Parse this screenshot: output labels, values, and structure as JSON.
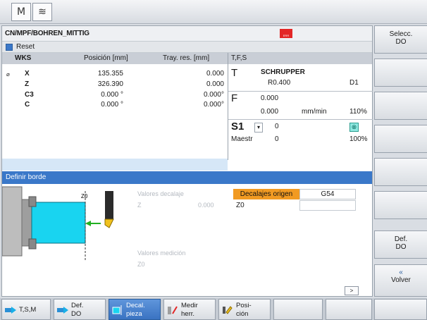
{
  "topbar": {
    "machine_icon": "M",
    "program_icon": "≋"
  },
  "program_path": "CN/MPF/BOHREN_MITTIG",
  "alarm_flag": {
    "color": "#e32626",
    "text": "ERR"
  },
  "reset": {
    "label": "Reset"
  },
  "position_panel": {
    "headers": {
      "wks": "WKS",
      "position": "Posición [mm]",
      "distance": "Tray. res. [mm]"
    },
    "rows": [
      {
        "mark": "⌀",
        "axis": "X",
        "position": "135.355",
        "distance": "0.000"
      },
      {
        "mark": "",
        "axis": "Z",
        "position": "326.390",
        "distance": "0.000"
      },
      {
        "mark": "",
        "axis": "C3",
        "position": "0.000 °",
        "distance": "0.000°"
      },
      {
        "mark": "",
        "axis": "C",
        "position": "0.000 °",
        "distance": "0.000°"
      }
    ]
  },
  "tfs_panel": {
    "header": "T,F,S",
    "t_label": "T",
    "tool_name": "SCHRUPPER",
    "tool_radius": "R0.400",
    "tool_d": "D1",
    "f_label": "F",
    "feed_value": "0.000",
    "feed_value2": "0.000",
    "feed_unit": "mm/min",
    "feed_override": "110%",
    "s_label": "S1",
    "spindle_value": "0",
    "spindle_mode": "Maestr",
    "spindle_value2": "0",
    "spindle_override": "100%"
  },
  "window_title": "Definir borde",
  "graphic": {
    "z0_label": "Z0"
  },
  "offset_form": {
    "offset_label": "Valores decalaje",
    "offset_z_label": "Z",
    "offset_z_value": "0.000",
    "measure_label": "Valores medición",
    "measure_z0_label": "Z0",
    "zero_offsets_label": "Decalajes origen",
    "zero_offset_value": "G54",
    "z0_label": "Z0",
    "more_button": ">"
  },
  "vertical_softkeys": {
    "select_do_1": "Selecc.",
    "select_do_2": "DO",
    "def_do_1": "Def.",
    "def_do_2": "DO",
    "back_arrow": "«",
    "back_label": "Volver"
  },
  "horizontal_softkeys": [
    {
      "line1": "T,S,M",
      "line2": "",
      "active": false
    },
    {
      "line1": "Def.",
      "line2": "DO",
      "active": false
    },
    {
      "line1": "Decal.",
      "line2": "pieza",
      "active": true
    },
    {
      "line1": "Medir",
      "line2": "herr.",
      "active": false
    },
    {
      "line1": "Posi-",
      "line2": "ción",
      "active": false
    }
  ],
  "colors": {
    "accent_blue": "#3a78c9",
    "orange": "#f19a22",
    "workpiece_cyan": "#19d4f0",
    "green_arrow": "#22b022"
  }
}
